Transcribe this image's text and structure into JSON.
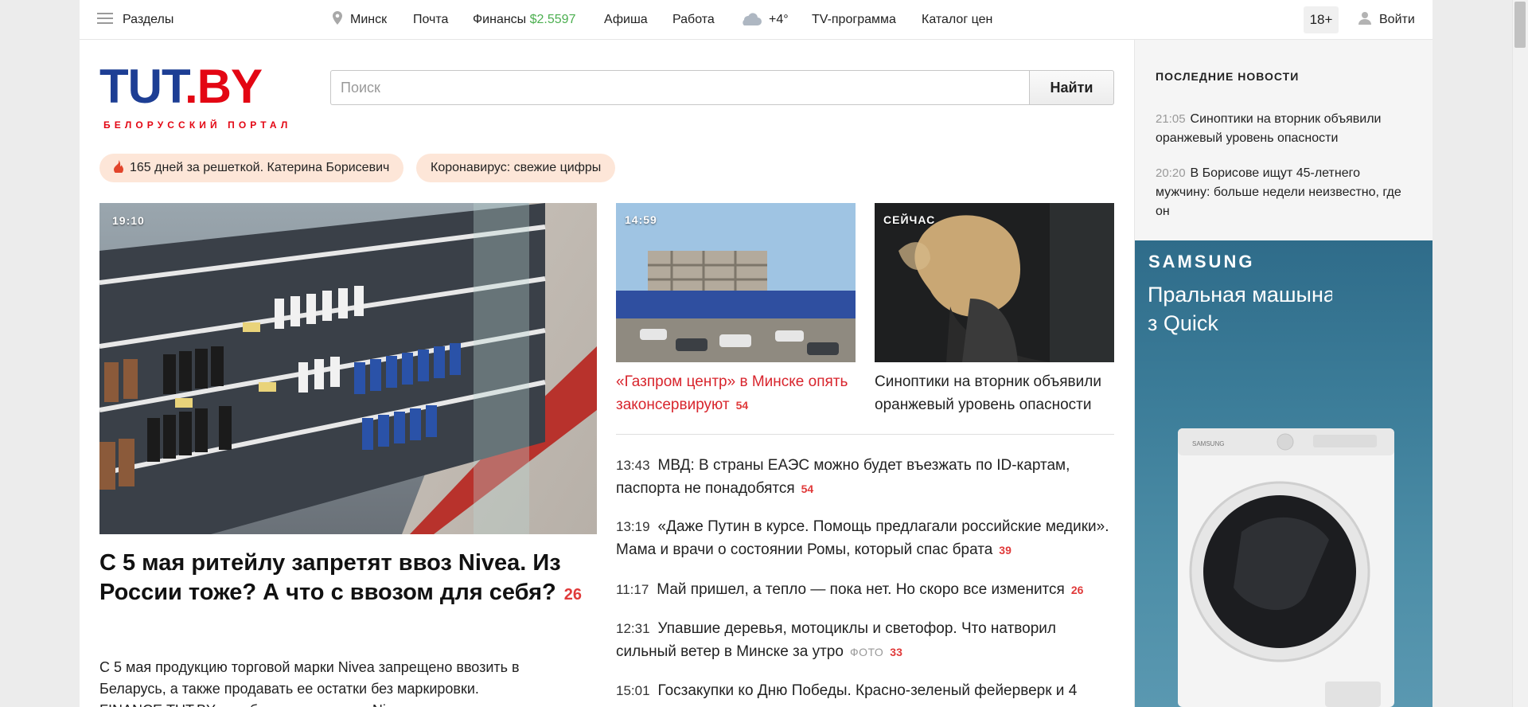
{
  "topbar": {
    "sections_label": "Разделы",
    "city": "Минск",
    "mail": "Почта",
    "finance_label": "Финансы",
    "finance_value": "$2.5597",
    "afisha": "Афиша",
    "work": "Работа",
    "weather": "+4°",
    "tv": "TV-программа",
    "prices": "Каталог цен",
    "age": "18+",
    "login": "Войти"
  },
  "logo": {
    "part1": "TUT",
    "part2": ".BY",
    "tagline": "БЕЛОРУССКИЙ ПОРТАЛ"
  },
  "search": {
    "placeholder": "Поиск",
    "button": "Найти"
  },
  "pills": [
    {
      "label": "165 дней за решеткой. Катерина Борисевич"
    },
    {
      "label": "Коронавирус: свежие цифры"
    }
  ],
  "main_story": {
    "time": "19:10",
    "title": "С 5 мая ритейлу запретят ввоз Nivea. Из России тоже? А что с ввозом для себя?",
    "comments": "26",
    "lead": "С 5 мая продукцию торговой марки Nivea запрещено ввозить в Беларусь, а также продавать ее остатки без маркировки. FINANCE.TUT.BY разобрался, можно ли Nivea"
  },
  "cards": [
    {
      "time": "14:59",
      "title": "«Газпром центр» в Минске опять законсервируют",
      "comments": "54"
    },
    {
      "time": "СЕЙЧАС",
      "title": "Синоптики на вторник объявили оранжевый уровень опасности"
    }
  ],
  "news": [
    {
      "time": "13:43",
      "title": "МВД: В страны ЕАЭС можно будет въезжать по ID-картам, паспорта не понадобятся",
      "comments": "54"
    },
    {
      "time": "13:19",
      "title": "«Даже Путин в курсе. Помощь предлагали российские медики». Мама и врачи о состоянии Ромы, который спас брата",
      "comments": "39"
    },
    {
      "time": "11:17",
      "title": "Май пришел, а тепло — пока нет. Но скоро все изменится",
      "comments": "26"
    },
    {
      "time": "12:31",
      "title": "Упавшие деревья, мотоциклы и светофор. Что натворил сильный ветер в Минске за утро",
      "tag": "ФОТО",
      "comments": "33"
    },
    {
      "time": "15:01",
      "title": "Госзакупки ко Дню Победы. Красно-зеленый фейерверк и 4"
    }
  ],
  "latest": {
    "heading": "ПОСЛЕДНИЕ НОВОСТИ",
    "items": [
      {
        "time": "21:05",
        "title": "Синоптики на вторник объявили оранжевый уровень опасности"
      },
      {
        "time": "20:20",
        "title": "В Борисове ищут 45-летнего мужчину: больше недели неизвестно, где он"
      }
    ]
  },
  "ad": {
    "brand": "SAMSUNG",
    "text_line1": "Пральная машына",
    "text_line2": "з Quick",
    "washer_brand": "SAMSUNG"
  },
  "colors": {
    "logo_blue": "#1d3e94",
    "logo_red": "#e30613",
    "comment_red": "#e03a3a",
    "link_red": "#d8252d",
    "finance_green": "#4caf50",
    "pill_bg": "#fde6d8"
  }
}
